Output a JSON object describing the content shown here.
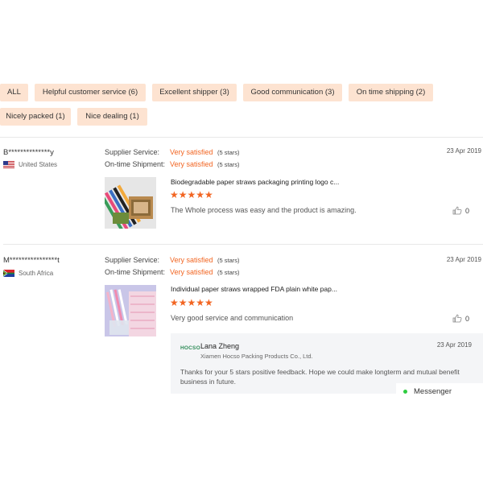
{
  "filters": [
    {
      "label": "ALL"
    },
    {
      "label": "Helpful customer service (6)"
    },
    {
      "label": "Excellent shipper (3)"
    },
    {
      "label": "Good communication (3)"
    },
    {
      "label": "On time shipping (2)"
    },
    {
      "label": "Nicely packed (1)"
    },
    {
      "label": "Nice dealing (1)"
    }
  ],
  "reviews": [
    {
      "buyer": "B**************y",
      "country": "United States",
      "flag_icon": "us-flag-icon",
      "supplier_service_label": "Supplier Service:",
      "supplier_service_value": "Very satisfied",
      "supplier_service_stars": "(5 stars)",
      "shipment_label": "On-time Shipment:",
      "shipment_value": "Very satisfied",
      "shipment_stars": "(5 stars)",
      "date": "23 Apr 2019",
      "product_title": "Biodegradable paper straws packaging printing logo c...",
      "rating": "★★★★★",
      "comment": "The Whole process was easy and the product is amazing.",
      "likes": "0"
    },
    {
      "buyer": "M****************t",
      "country": "South Africa",
      "flag_icon": "za-flag-icon",
      "supplier_service_label": "Supplier Service:",
      "supplier_service_value": "Very satisfied",
      "supplier_service_stars": "(5 stars)",
      "shipment_label": "On-time Shipment:",
      "shipment_value": "Very satisfied",
      "shipment_stars": "(5 stars)",
      "date": "23 Apr 2019",
      "product_title": "Individual paper straws wrapped FDA plain white pap...",
      "rating": "★★★★★",
      "comment": "Very good service and communication",
      "likes": "0",
      "reply": {
        "logo": "HOCSO",
        "name": "Lana Zheng",
        "company": "Xiamen Hocso Packing Products Co., Ltd.",
        "date": "23 Apr 2019",
        "text": "Thanks for your 5 stars positive feedback. Hope we could make longterm and mutual benefit business in future."
      }
    }
  ],
  "messenger": {
    "label": "Messenger"
  },
  "colors": {
    "accent": "#f26522",
    "tag_bg": "#fde3d1",
    "online": "#2ecc40"
  }
}
